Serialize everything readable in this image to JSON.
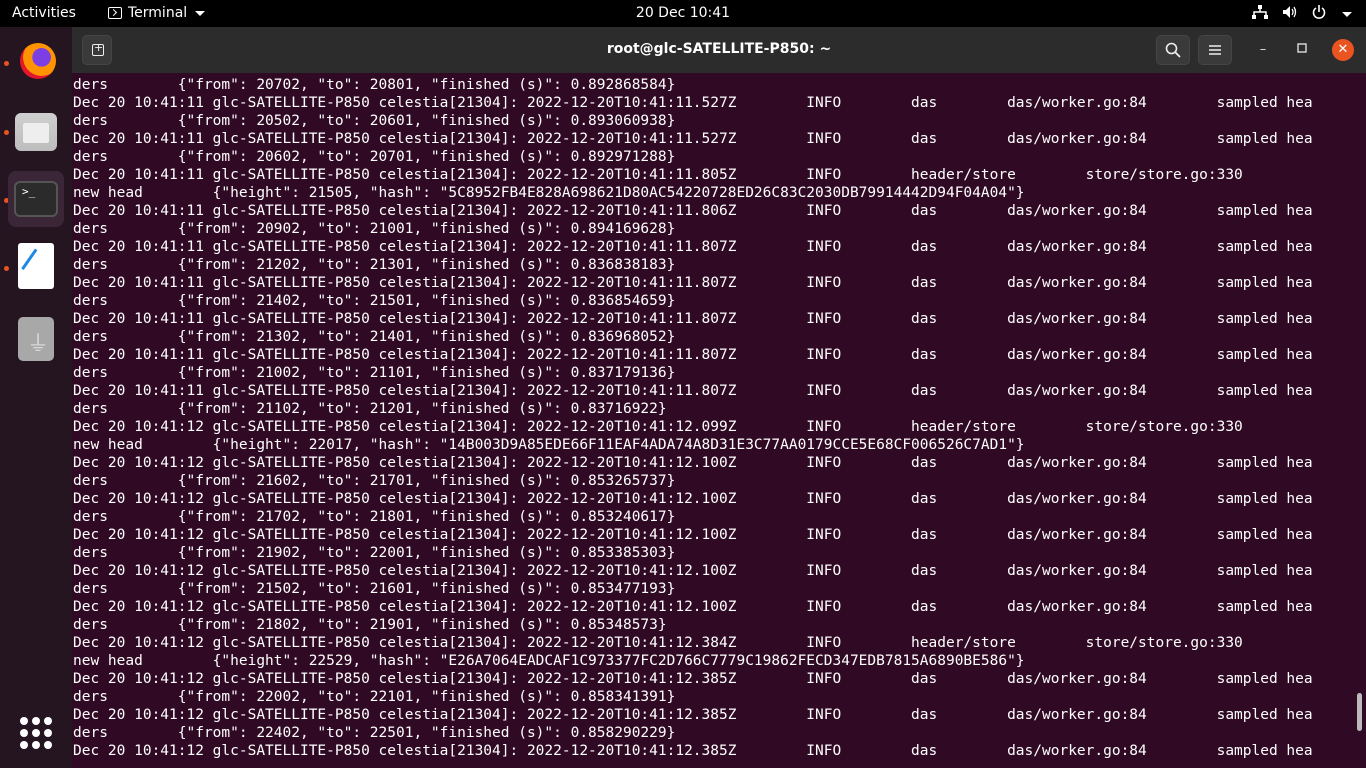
{
  "topbar": {
    "activities": "Activities",
    "app_name": "Terminal",
    "clock": "20 Dec  10:41"
  },
  "dock": {
    "items": [
      "firefox",
      "files",
      "terminal",
      "text-editor",
      "usb-drive",
      "show-applications"
    ]
  },
  "window": {
    "title": "root@glc-SATELLITE-P850: ~"
  },
  "terminal": {
    "lines": [
      "ders        {\"from\": 20702, \"to\": 20801, \"finished (s)\": 0.892868584}",
      "Dec 20 10:41:11 glc-SATELLITE-P850 celestia[21304]: 2022-12-20T10:41:11.527Z        INFO        das        das/worker.go:84        sampled hea",
      "ders        {\"from\": 20502, \"to\": 20601, \"finished (s)\": 0.893060938}",
      "Dec 20 10:41:11 glc-SATELLITE-P850 celestia[21304]: 2022-12-20T10:41:11.527Z        INFO        das        das/worker.go:84        sampled hea",
      "ders        {\"from\": 20602, \"to\": 20701, \"finished (s)\": 0.892971288}",
      "Dec 20 10:41:11 glc-SATELLITE-P850 celestia[21304]: 2022-12-20T10:41:11.805Z        INFO        header/store        store/store.go:330",
      "new head        {\"height\": 21505, \"hash\": \"5C8952FB4E828A698621D80AC54220728ED26C83C2030DB79914442D94F04A04\"}",
      "Dec 20 10:41:11 glc-SATELLITE-P850 celestia[21304]: 2022-12-20T10:41:11.806Z        INFO        das        das/worker.go:84        sampled hea",
      "ders        {\"from\": 20902, \"to\": 21001, \"finished (s)\": 0.894169628}",
      "Dec 20 10:41:11 glc-SATELLITE-P850 celestia[21304]: 2022-12-20T10:41:11.807Z        INFO        das        das/worker.go:84        sampled hea",
      "ders        {\"from\": 21202, \"to\": 21301, \"finished (s)\": 0.836838183}",
      "Dec 20 10:41:11 glc-SATELLITE-P850 celestia[21304]: 2022-12-20T10:41:11.807Z        INFO        das        das/worker.go:84        sampled hea",
      "ders        {\"from\": 21402, \"to\": 21501, \"finished (s)\": 0.836854659}",
      "Dec 20 10:41:11 glc-SATELLITE-P850 celestia[21304]: 2022-12-20T10:41:11.807Z        INFO        das        das/worker.go:84        sampled hea",
      "ders        {\"from\": 21302, \"to\": 21401, \"finished (s)\": 0.836968052}",
      "Dec 20 10:41:11 glc-SATELLITE-P850 celestia[21304]: 2022-12-20T10:41:11.807Z        INFO        das        das/worker.go:84        sampled hea",
      "ders        {\"from\": 21002, \"to\": 21101, \"finished (s)\": 0.837179136}",
      "Dec 20 10:41:11 glc-SATELLITE-P850 celestia[21304]: 2022-12-20T10:41:11.807Z        INFO        das        das/worker.go:84        sampled hea",
      "ders        {\"from\": 21102, \"to\": 21201, \"finished (s)\": 0.83716922}",
      "Dec 20 10:41:12 glc-SATELLITE-P850 celestia[21304]: 2022-12-20T10:41:12.099Z        INFO        header/store        store/store.go:330",
      "new head        {\"height\": 22017, \"hash\": \"14B003D9A85EDE66F11EAF4ADA74A8D31E3C77AA0179CCE5E68CF006526C7AD1\"}",
      "Dec 20 10:41:12 glc-SATELLITE-P850 celestia[21304]: 2022-12-20T10:41:12.100Z        INFO        das        das/worker.go:84        sampled hea",
      "ders        {\"from\": 21602, \"to\": 21701, \"finished (s)\": 0.853265737}",
      "Dec 20 10:41:12 glc-SATELLITE-P850 celestia[21304]: 2022-12-20T10:41:12.100Z        INFO        das        das/worker.go:84        sampled hea",
      "ders        {\"from\": 21702, \"to\": 21801, \"finished (s)\": 0.853240617}",
      "Dec 20 10:41:12 glc-SATELLITE-P850 celestia[21304]: 2022-12-20T10:41:12.100Z        INFO        das        das/worker.go:84        sampled hea",
      "ders        {\"from\": 21902, \"to\": 22001, \"finished (s)\": 0.853385303}",
      "Dec 20 10:41:12 glc-SATELLITE-P850 celestia[21304]: 2022-12-20T10:41:12.100Z        INFO        das        das/worker.go:84        sampled hea",
      "ders        {\"from\": 21502, \"to\": 21601, \"finished (s)\": 0.853477193}",
      "Dec 20 10:41:12 glc-SATELLITE-P850 celestia[21304]: 2022-12-20T10:41:12.100Z        INFO        das        das/worker.go:84        sampled hea",
      "ders        {\"from\": 21802, \"to\": 21901, \"finished (s)\": 0.85348573}",
      "Dec 20 10:41:12 glc-SATELLITE-P850 celestia[21304]: 2022-12-20T10:41:12.384Z        INFO        header/store        store/store.go:330",
      "new head        {\"height\": 22529, \"hash\": \"E26A7064EADCAF1C973377FC2D766C7779C19862FECD347EDB7815A6890BE586\"}",
      "Dec 20 10:41:12 glc-SATELLITE-P850 celestia[21304]: 2022-12-20T10:41:12.385Z        INFO        das        das/worker.go:84        sampled hea",
      "ders        {\"from\": 22002, \"to\": 22101, \"finished (s)\": 0.858341391}",
      "Dec 20 10:41:12 glc-SATELLITE-P850 celestia[21304]: 2022-12-20T10:41:12.385Z        INFO        das        das/worker.go:84        sampled hea",
      "ders        {\"from\": 22402, \"to\": 22501, \"finished (s)\": 0.858290229}",
      "Dec 20 10:41:12 glc-SATELLITE-P850 celestia[21304]: 2022-12-20T10:41:12.385Z        INFO        das        das/worker.go:84        sampled hea"
    ]
  },
  "colors": {
    "terminal_bg": "#300a24",
    "accent": "#e95420"
  }
}
